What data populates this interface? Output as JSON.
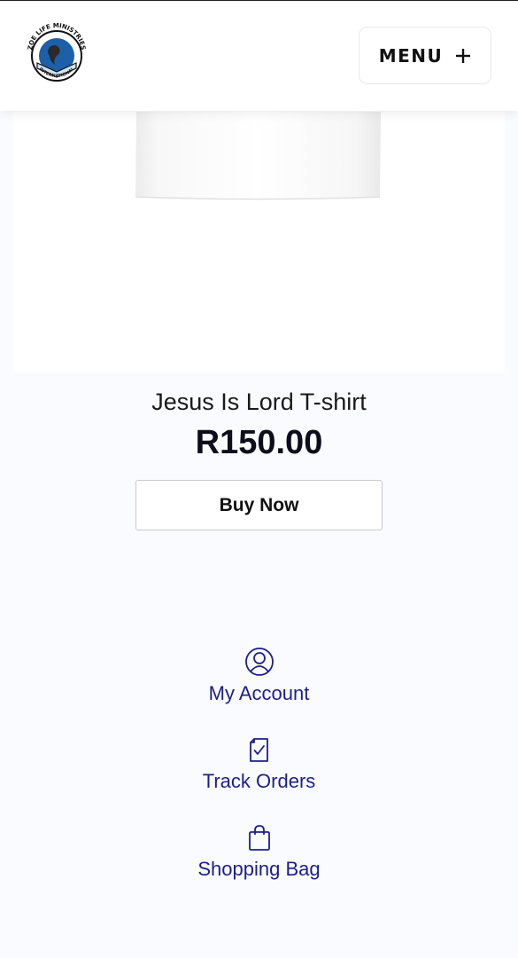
{
  "header": {
    "logo_text_top": "ZOE LIFE MINISTRIES",
    "logo_text_bottom": "INTERNATIONAL",
    "menu_label": "MENU"
  },
  "product": {
    "title": "Jesus Is Lord T-shirt",
    "price": "R150.00",
    "buy_label": "Buy Now"
  },
  "footer_links": [
    {
      "label": "My Account",
      "icon": "user-circle-icon"
    },
    {
      "label": "Track Orders",
      "icon": "clipboard-check-icon"
    },
    {
      "label": "Shopping Bag",
      "icon": "shopping-bag-icon"
    }
  ],
  "colors": {
    "link": "#1d1f8a",
    "background": "#fafbfe"
  }
}
